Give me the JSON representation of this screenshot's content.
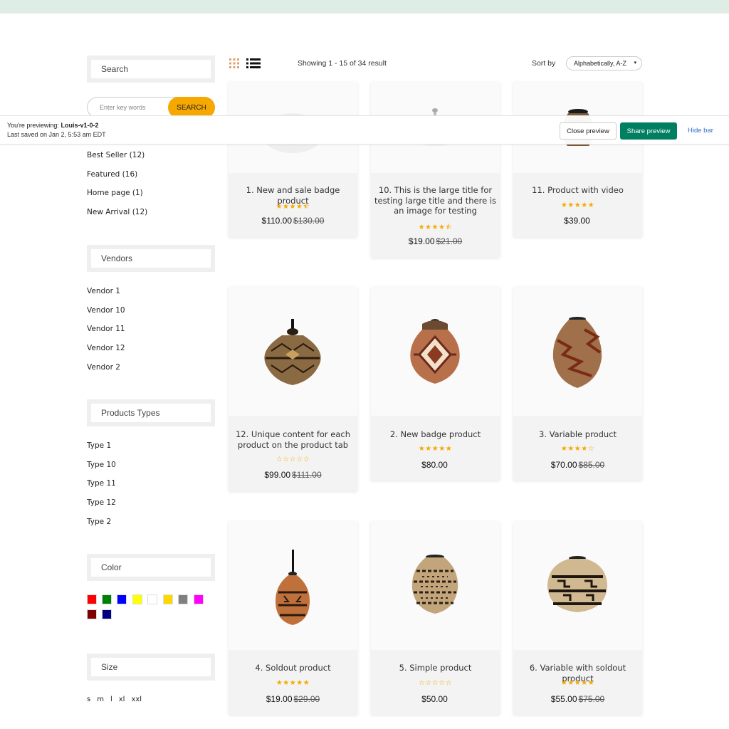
{
  "sidebar": {
    "search_heading": "Search",
    "keyword_placeholder": "Enter key words",
    "search_button": "SEARCH",
    "collections": [
      "Best Seller (12)",
      "Featured (16)",
      "Home page (1)",
      "New Arrival (12)"
    ],
    "vendors_heading": "Vendors",
    "vendors": [
      "Vendor 1",
      "Vendor 10",
      "Vendor 11",
      "Vendor 12",
      "Vendor 2"
    ],
    "types_heading": "Products Types",
    "types": [
      "Type 1",
      "Type 10",
      "Type 11",
      "Type 12",
      "Type 2"
    ],
    "color_heading": "Color",
    "colors": [
      "#ff0000",
      "#008000",
      "#0000ff",
      "#ffff00",
      "#ffffff",
      "#ffd700",
      "#808080",
      "#ff00ff",
      "#800000",
      "#000080"
    ],
    "size_heading": "Size",
    "sizes": [
      "s",
      "m",
      "l",
      "xl",
      "xxl"
    ]
  },
  "preview_bar": {
    "previewing_prefix": "You're previewing:",
    "theme_name": "Louis-v1-0-2",
    "last_saved": "Last saved on Jan 2, 5:53 am EDT",
    "close_label": "Close preview",
    "share_label": "Share preview",
    "hide_label": "Hide bar"
  },
  "toolbar": {
    "showing": "Showing 1 - 15 of 34 result",
    "sort_label": "Sort by",
    "sort_value": "Alphabetically, A-Z"
  },
  "colors": {
    "accent": "#f6a800",
    "share_green": "#008060",
    "link_blue": "#2c6ecb",
    "top_strip": "#deeee6"
  },
  "products": [
    {
      "title": "1. New and sale badge product",
      "rating": 4.5,
      "price": "$110.00",
      "old_price": "$130.00",
      "stars": "★★★★⯪"
    },
    {
      "title": "10. This is the large title for testing large title and there is an image for testing",
      "rating": 4.5,
      "price": "$19.00",
      "old_price": "$21.00",
      "stars": "★★★★⯪"
    },
    {
      "title": "11. Product with video",
      "rating": 5,
      "price": "$39.00",
      "old_price": "",
      "stars": "★★★★★"
    },
    {
      "title": "12. Unique content for each product on the product tab",
      "rating": 0,
      "price": "$99.00",
      "old_price": "$111.00",
      "stars": "☆☆☆☆☆"
    },
    {
      "title": "2. New badge product",
      "rating": 5,
      "price": "$80.00",
      "old_price": "",
      "stars": "★★★★★"
    },
    {
      "title": "3. Variable product",
      "rating": 4,
      "price": "$70.00",
      "old_price": "$85.00",
      "stars": "★★★★☆"
    },
    {
      "title": "4. Soldout product",
      "rating": 5,
      "price": "$19.00",
      "old_price": "$29.00",
      "stars": "★★★★★"
    },
    {
      "title": "5. Simple product",
      "rating": 0,
      "price": "$50.00",
      "old_price": "",
      "stars": "☆☆☆☆☆"
    },
    {
      "title": "6. Variable with soldout product",
      "rating": 5,
      "price": "$55.00",
      "old_price": "$75.00",
      "stars": "★★★★★"
    }
  ]
}
